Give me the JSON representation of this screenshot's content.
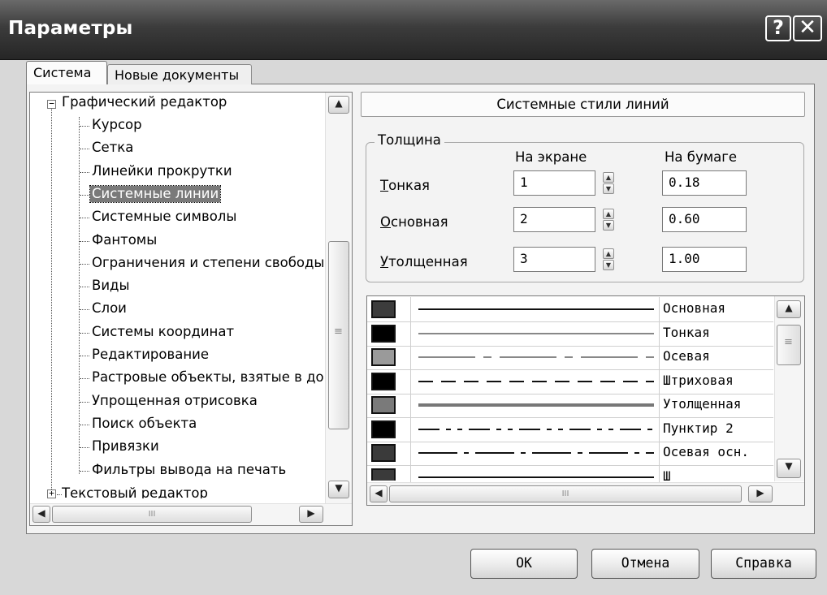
{
  "window": {
    "title": "Параметры",
    "help_glyph": "?",
    "close_glyph": "✕"
  },
  "tabs": [
    {
      "label": "Система",
      "active": true
    },
    {
      "label": "Новые документы",
      "active": false
    }
  ],
  "tree": {
    "root": {
      "label": "Графический редактор",
      "expander": "−"
    },
    "children": [
      "Курсор",
      "Сетка",
      "Линейки прокрутки",
      "Системные линии",
      "Системные символы",
      "Фантомы",
      "Ограничения и степени свободы",
      "Виды",
      "Слои",
      "Системы координат",
      "Редактирование",
      "Растровые объекты, взятые в документ",
      "Упрощенная отрисовка",
      "Поиск объекта",
      "Привязки",
      "Фильтры вывода на печать"
    ],
    "selected_index": 3,
    "next_root": {
      "label": "Текстовый редактор",
      "expander": "+"
    }
  },
  "panel": {
    "header": "Системные стили линий",
    "group_title": "Толщина",
    "col_screen": "На экране",
    "col_paper": "На бумаге",
    "rows": [
      {
        "hot": "Т",
        "rest": "онкая",
        "screen": "1",
        "paper": "0.18"
      },
      {
        "hot": "О",
        "rest": "сновная",
        "screen": "2",
        "paper": "0.60"
      },
      {
        "hot": "У",
        "rest": "толщенная",
        "screen": "3",
        "paper": "1.00"
      }
    ]
  },
  "line_styles": [
    {
      "name": "Основная",
      "swatch": "#3c3c3c",
      "dash": "",
      "width": 2
    },
    {
      "name": "Тонкая",
      "swatch": "#000000",
      "dash": "",
      "width": 1
    },
    {
      "name": "Осевая",
      "swatch": "#9a9a9a",
      "dash": "70 10 10 10",
      "width": 1
    },
    {
      "name": "Штриховая",
      "swatch": "#000000",
      "dash": "18 10",
      "width": 2
    },
    {
      "name": "Утолщенная",
      "swatch": "#7a7a7a",
      "dash": "",
      "width": 4
    },
    {
      "name": "Пунктир 2",
      "swatch": "#000000",
      "dash": "26 8 6 8 6 8",
      "width": 2
    },
    {
      "name": "Осевая осн.",
      "swatch": "#3a3a3a",
      "dash": "48 8 6 8",
      "width": 2
    },
    {
      "name": "Ш",
      "swatch": "#3a3a3a",
      "dash": "",
      "width": 2
    }
  ],
  "scroll_glyphs": {
    "up": "▲",
    "down": "▼",
    "left": "◀",
    "right": "▶",
    "grip": "≡",
    "grip_h": "III"
  },
  "buttons": {
    "ok": "OK",
    "cancel": "Отмена",
    "help": "Справка"
  }
}
